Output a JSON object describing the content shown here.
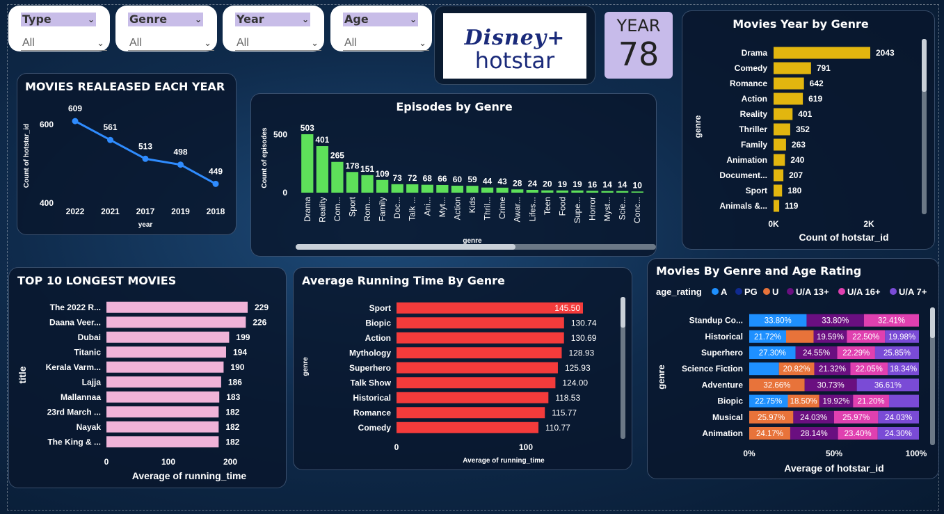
{
  "slicers": [
    {
      "label": "Type",
      "value": "All"
    },
    {
      "label": "Genre",
      "value": "All"
    },
    {
      "label": "Year",
      "value": "All"
    },
    {
      "label": "Age",
      "value": "All"
    }
  ],
  "logo": {
    "line1": "Disney+",
    "line2": "hotstar"
  },
  "kpi": {
    "label": "YEAR",
    "value": "78"
  },
  "colors": {
    "line": "#2f8cff",
    "episodes": "#5ee05a",
    "year_genre": "#e2b60f",
    "longest": "#f0b3d8",
    "running": "#f43b3b",
    "A": "#1e90ff",
    "PG": "#102a8f",
    "U": "#e8733a",
    "U/A 13+": "#6a0f80",
    "U/A 16+": "#e040b0",
    "U/A 7+": "#7a4bd6"
  },
  "chart_data": [
    {
      "id": "movies_each_year",
      "type": "line",
      "title": "MOVIES REALEASED EACH YEAR",
      "xlabel": "year",
      "ylabel": "Count of hotstar_id",
      "categories": [
        "2022",
        "2021",
        "2017",
        "2019",
        "2018"
      ],
      "values": [
        609,
        561,
        513,
        498,
        449
      ],
      "ylim": [
        400,
        650
      ],
      "yticks": [
        400,
        600
      ]
    },
    {
      "id": "episodes_by_genre",
      "type": "bar",
      "title": "Episodes by Genre",
      "xlabel": "genre",
      "ylabel": "Count of episodes",
      "categories": [
        "Drama",
        "Reality",
        "Com...",
        "Sport",
        "Rom...",
        "Family",
        "Doc...",
        "Talk ...",
        "Ani...",
        "Myt...",
        "Action",
        "Kids",
        "Thril...",
        "Crime",
        "Awar...",
        "Lifes...",
        "Teen",
        "Food",
        "Supe...",
        "Horror",
        "Myst...",
        "Scie...",
        "Conc..."
      ],
      "values": [
        503,
        401,
        265,
        178,
        151,
        109,
        73,
        72,
        68,
        66,
        60,
        59,
        44,
        43,
        28,
        24,
        20,
        19,
        19,
        16,
        14,
        14,
        10
      ],
      "yticks": [
        0,
        500
      ]
    },
    {
      "id": "movies_year_by_genre",
      "type": "bar",
      "title": "Movies Year by Genre",
      "xlabel": "Count of hotstar_id",
      "ylabel": "genre",
      "categories": [
        "Drama",
        "Comedy",
        "Romance",
        "Action",
        "Reality",
        "Thriller",
        "Family",
        "Animation",
        "Document...",
        "Sport",
        "Animals &..."
      ],
      "values": [
        2043,
        791,
        642,
        619,
        401,
        352,
        263,
        240,
        207,
        180,
        119
      ],
      "xticks": [
        "0K",
        "2K"
      ]
    },
    {
      "id": "top10_longest",
      "type": "bar",
      "title": "TOP 10 LONGEST MOVIES",
      "xlabel": "Average of running_time",
      "ylabel": "title",
      "categories": [
        "The 2022 R...",
        "Daana Veer...",
        "Dubai",
        "Titanic",
        "Kerala Varm...",
        "Lajja",
        "Mallannaa",
        "23rd March ...",
        "Nayak",
        "The King & ..."
      ],
      "values": [
        229,
        226,
        199,
        194,
        190,
        186,
        183,
        182,
        182,
        182
      ],
      "xticks": [
        0,
        100,
        200
      ]
    },
    {
      "id": "avg_running_time",
      "type": "bar",
      "title": "Average Running Time By Genre",
      "xlabel": "Average of running_time",
      "ylabel": "genre",
      "categories": [
        "Sport",
        "Biopic",
        "Action",
        "Mythology",
        "Superhero",
        "Talk Show",
        "Historical",
        "Romance",
        "Comedy"
      ],
      "values": [
        145.5,
        130.74,
        130.69,
        128.93,
        125.93,
        124.0,
        118.53,
        115.77,
        110.77
      ],
      "labels": [
        "145.50",
        "130.74",
        "130.69",
        "128.93",
        "125.93",
        "124.00",
        "118.53",
        "115.77",
        "110.77"
      ],
      "xticks": [
        0,
        100
      ]
    },
    {
      "id": "genre_age_rating",
      "type": "bar",
      "title": "Movies By Genre and Age Rating",
      "legend_title": "age_rating",
      "xlabel": "Average of hotstar_id",
      "ylabel": "genre",
      "xticks": [
        "0%",
        "50%",
        "100%"
      ],
      "series_names": [
        "A",
        "PG",
        "U",
        "U/A 13+",
        "U/A 16+",
        "U/A 7+"
      ],
      "rows": [
        {
          "name": "Standup Co...",
          "segments": [
            {
              "s": "A",
              "v": 33.8,
              "label": "33.80%"
            },
            {
              "s": "U/A 13+",
              "v": 33.8,
              "label": "33.80%"
            },
            {
              "s": "U/A 16+",
              "v": 32.41,
              "label": "32.41%"
            }
          ]
        },
        {
          "name": "Historical",
          "segments": [
            {
              "s": "A",
              "v": 21.72,
              "label": "21.72%"
            },
            {
              "s": "U",
              "v": 16.2,
              "label": ""
            },
            {
              "s": "U/A 13+",
              "v": 19.59,
              "label": "19.59%"
            },
            {
              "s": "U/A 16+",
              "v": 22.5,
              "label": "22.50%"
            },
            {
              "s": "U/A 7+",
              "v": 19.98,
              "label": "19.98%"
            }
          ]
        },
        {
          "name": "Superhero",
          "segments": [
            {
              "s": "A",
              "v": 27.3,
              "label": "27.30%"
            },
            {
              "s": "U/A 13+",
              "v": 24.55,
              "label": "24.55%"
            },
            {
              "s": "U/A 16+",
              "v": 22.29,
              "label": "22.29%"
            },
            {
              "s": "U/A 7+",
              "v": 25.85,
              "label": "25.85%"
            }
          ]
        },
        {
          "name": "Science Fiction",
          "segments": [
            {
              "s": "A",
              "v": 17.5,
              "label": ""
            },
            {
              "s": "U",
              "v": 20.82,
              "label": "20.82%"
            },
            {
              "s": "U/A 13+",
              "v": 21.32,
              "label": "21.32%"
            },
            {
              "s": "U/A 16+",
              "v": 22.05,
              "label": "22.05%"
            },
            {
              "s": "U/A 7+",
              "v": 18.34,
              "label": "18.34%"
            }
          ]
        },
        {
          "name": "Adventure",
          "segments": [
            {
              "s": "U",
              "v": 32.66,
              "label": "32.66%"
            },
            {
              "s": "U/A 13+",
              "v": 30.73,
              "label": "30.73%"
            },
            {
              "s": "U/A 7+",
              "v": 36.61,
              "label": "36.61%"
            }
          ]
        },
        {
          "name": "Biopic",
          "segments": [
            {
              "s": "A",
              "v": 22.75,
              "label": "22.75%"
            },
            {
              "s": "U",
              "v": 18.5,
              "label": "18.50%"
            },
            {
              "s": "U/A 13+",
              "v": 19.92,
              "label": "19.92%"
            },
            {
              "s": "U/A 16+",
              "v": 21.2,
              "label": "21.20%"
            },
            {
              "s": "U/A 7+",
              "v": 17.63,
              "label": ""
            }
          ]
        },
        {
          "name": "Musical",
          "segments": [
            {
              "s": "U",
              "v": 25.97,
              "label": "25.97%"
            },
            {
              "s": "U/A 13+",
              "v": 24.03,
              "label": "24.03%"
            },
            {
              "s": "U/A 16+",
              "v": 25.97,
              "label": "25.97%"
            },
            {
              "s": "U/A 7+",
              "v": 24.03,
              "label": "24.03%"
            }
          ]
        },
        {
          "name": "Animation",
          "segments": [
            {
              "s": "U",
              "v": 24.17,
              "label": "24.17%"
            },
            {
              "s": "U/A 13+",
              "v": 28.14,
              "label": "28.14%"
            },
            {
              "s": "U/A 16+",
              "v": 23.4,
              "label": "23.40%"
            },
            {
              "s": "U/A 7+",
              "v": 24.3,
              "label": "24.30%"
            }
          ]
        }
      ]
    }
  ]
}
